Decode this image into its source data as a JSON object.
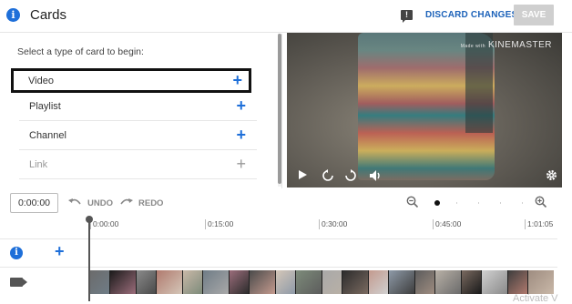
{
  "header": {
    "title": "Cards",
    "discard_label": "DISCARD CHANGES",
    "save_label": "SAVE",
    "info_glyph": "i",
    "feedback_glyph": "!"
  },
  "card_panel": {
    "prompt": "Select a type of card to begin:",
    "types": [
      {
        "label": "Video",
        "state": "selected"
      },
      {
        "label": "Playlist",
        "state": "enabled"
      },
      {
        "label": "Channel",
        "state": "enabled"
      },
      {
        "label": "Link",
        "state": "disabled"
      }
    ],
    "add_glyph": "+"
  },
  "player": {
    "watermark_small": "Made with",
    "watermark": "KINEMASTER"
  },
  "toolbar": {
    "timecode": "0:00:00",
    "undo_label": "UNDO",
    "redo_label": "REDO",
    "zoom_level": 0
  },
  "timeline": {
    "ticks": [
      "0:00:00",
      "0:15:00",
      "0:30:00",
      "0:45:00",
      "1:01:05"
    ],
    "track_add_glyph": "+",
    "info_glyph": "i"
  },
  "overlay": {
    "activate_text": "Activate V"
  },
  "colors": {
    "accent": "#1e6fd9",
    "discard": "#1c62b9",
    "save_disabled": "#cfcfcf",
    "selection_outline": "#111111"
  }
}
